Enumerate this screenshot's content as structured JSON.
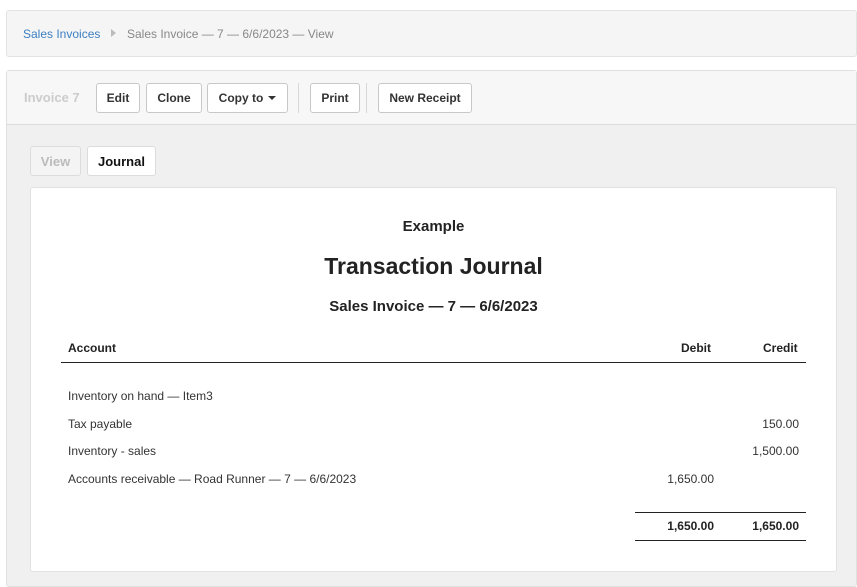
{
  "breadcrumb": {
    "parent": "Sales Invoices",
    "current": "Sales Invoice — 7 — 6/6/2023 — View"
  },
  "toolbar": {
    "title": "Invoice 7",
    "edit": "Edit",
    "clone": "Clone",
    "copy_to": "Copy to",
    "print": "Print",
    "new_receipt": "New Receipt"
  },
  "tabs": {
    "view": "View",
    "journal": "Journal",
    "active": "Journal"
  },
  "report": {
    "company": "Example",
    "title": "Transaction Journal",
    "subtitle": "Sales Invoice — 7 — 6/6/2023",
    "columns": {
      "account": "Account",
      "debit": "Debit",
      "credit": "Credit"
    },
    "rows": [
      {
        "account": "Inventory on hand — Item3",
        "debit": "",
        "credit": ""
      },
      {
        "account": "Tax payable",
        "debit": "",
        "credit": "150.00"
      },
      {
        "account": "Inventory - sales",
        "debit": "",
        "credit": "1,500.00"
      },
      {
        "account": "Accounts receivable — Road Runner — 7 — 6/6/2023",
        "debit": "1,650.00",
        "credit": ""
      }
    ],
    "totals": {
      "debit": "1,650.00",
      "credit": "1,650.00"
    }
  },
  "colors": {
    "link": "#3c7fc1",
    "muted": "#888888"
  }
}
